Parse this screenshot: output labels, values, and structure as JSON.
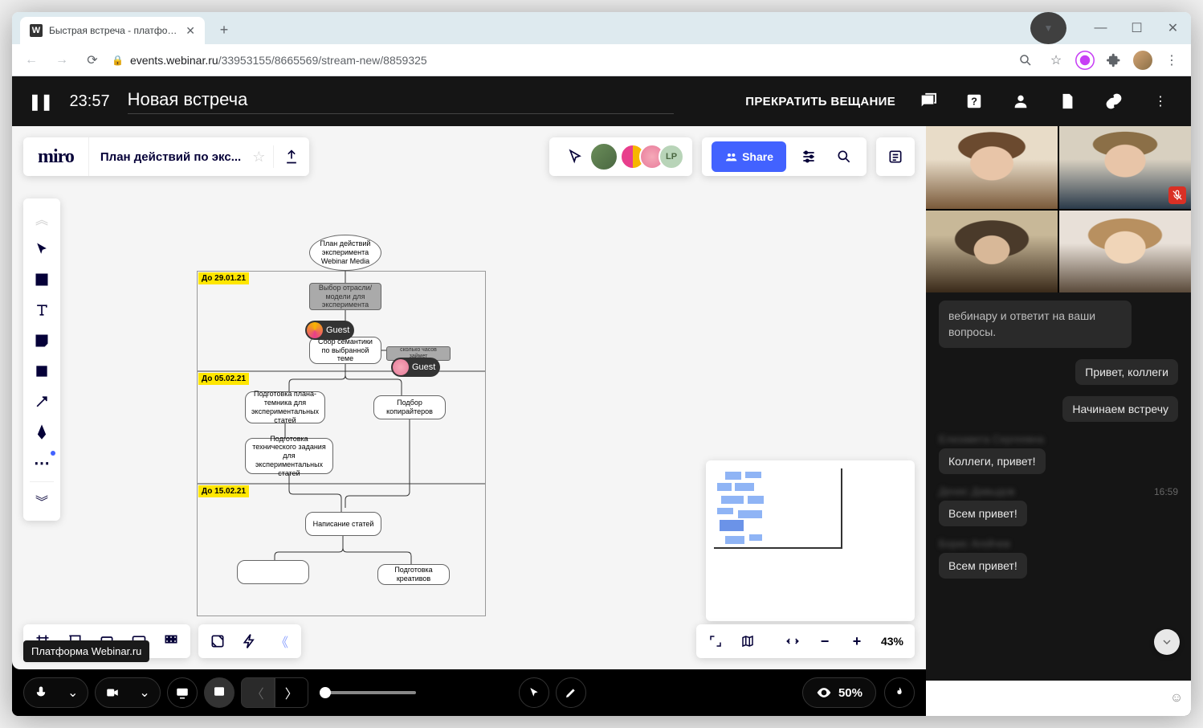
{
  "browser": {
    "tab_title": "Быстрая встреча - платформа W",
    "url_domain": "events.webinar.ru",
    "url_path": "/33953155/8665569/stream-new/8859325"
  },
  "header": {
    "timer": "23:57",
    "meeting_title": "Новая встреча",
    "stop_label": "ПРЕКРАТИТЬ ВЕЩАНИЕ"
  },
  "chat": {
    "system_msg": "вебинару и ответит на ваши вопросы.",
    "me1": "Привет, коллеги",
    "me2": "Начинаем встречу",
    "user1_name": "Елизавета Сергеевна",
    "user1_msg": "Коллеги, привет!",
    "user2_name": "Денис Давыдов",
    "user2_time": "16:59",
    "user2_msg": "Всем привет!",
    "user3_name": "Борис Агейчев",
    "user3_msg": "Всем привет!",
    "input_placeholder": ""
  },
  "bottombar": {
    "viewers_pct": "50%"
  },
  "miro": {
    "logo": "miro",
    "board_title": "План действий по экс...",
    "share_label": "Share",
    "zoom_pct": "43%",
    "collab_avatar_initials": "LP",
    "guest_label": "Guest",
    "tooltip": "Платформа Webinar.ru",
    "flowchart": {
      "start": "План действий эксперимента Webinar Media",
      "date1": "До 29.01.21",
      "node1": "Выбор отрасли/модели для эксперимента",
      "node2": "Сбор семантики по выбранной теме",
      "node3": "сколько часов займет",
      "date2": "До 05.02.21",
      "node4": "Подготовка плана-темника для экспериментальных статей",
      "node5": "Подбор копирайтеров",
      "node6": "Подготовка технического задания для экспериментальных статей",
      "date3": "До 15.02.21",
      "node7": "Написание статей",
      "node8": "Подготовка креативов"
    }
  }
}
